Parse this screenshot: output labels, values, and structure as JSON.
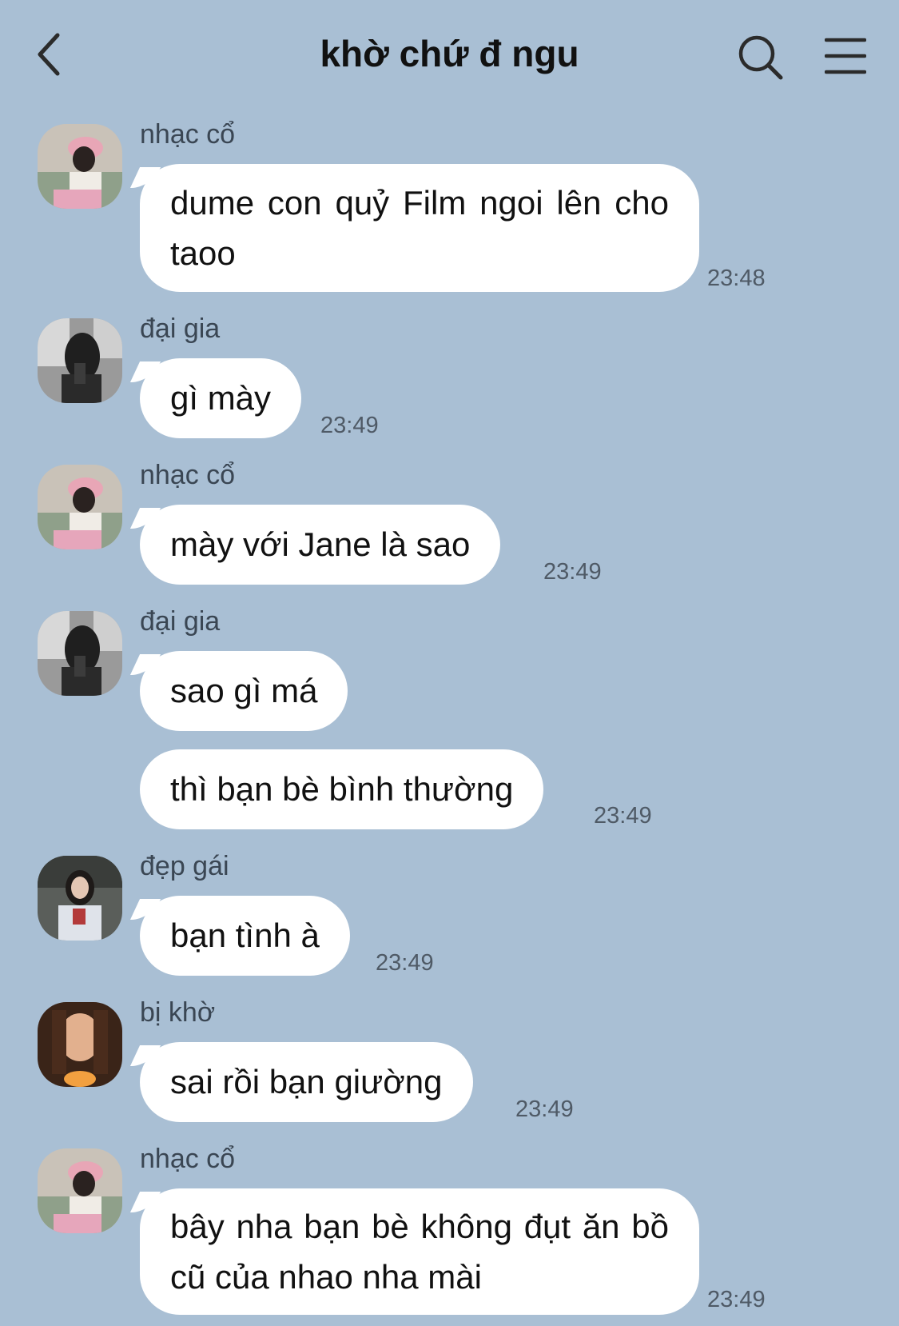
{
  "header": {
    "title": "khờ chứ đ ngu"
  },
  "messages": [
    {
      "sender": "nhạc cổ",
      "texts": [
        "dume con quỷ Film ngoi lên cho taoo"
      ],
      "time": "23:48"
    },
    {
      "sender": "đại gia",
      "texts": [
        "gì mày"
      ],
      "time": "23:49"
    },
    {
      "sender": "nhạc cổ",
      "texts": [
        "mày với Jane là sao"
      ],
      "time": "23:49"
    },
    {
      "sender": "đại gia",
      "texts": [
        "sao gì má",
        "thì bạn bè bình thường"
      ],
      "time": "23:49"
    },
    {
      "sender": "đẹp gái",
      "texts": [
        "bạn tình à"
      ],
      "time": "23:49"
    },
    {
      "sender": "bị khờ",
      "texts": [
        "sai rồi bạn giường"
      ],
      "time": "23:49"
    },
    {
      "sender": "nhạc cổ",
      "texts": [
        "bây nha bạn bè không đụt ăn bồ cũ của nhao nha mài"
      ],
      "time": "23:49"
    }
  ],
  "colors": {
    "background": "#a9bfd4",
    "bubble": "#ffffff",
    "text": "#111111",
    "meta": "#4f5a66"
  },
  "icons": [
    "back-arrow-icon",
    "search-icon",
    "menu-icon"
  ]
}
